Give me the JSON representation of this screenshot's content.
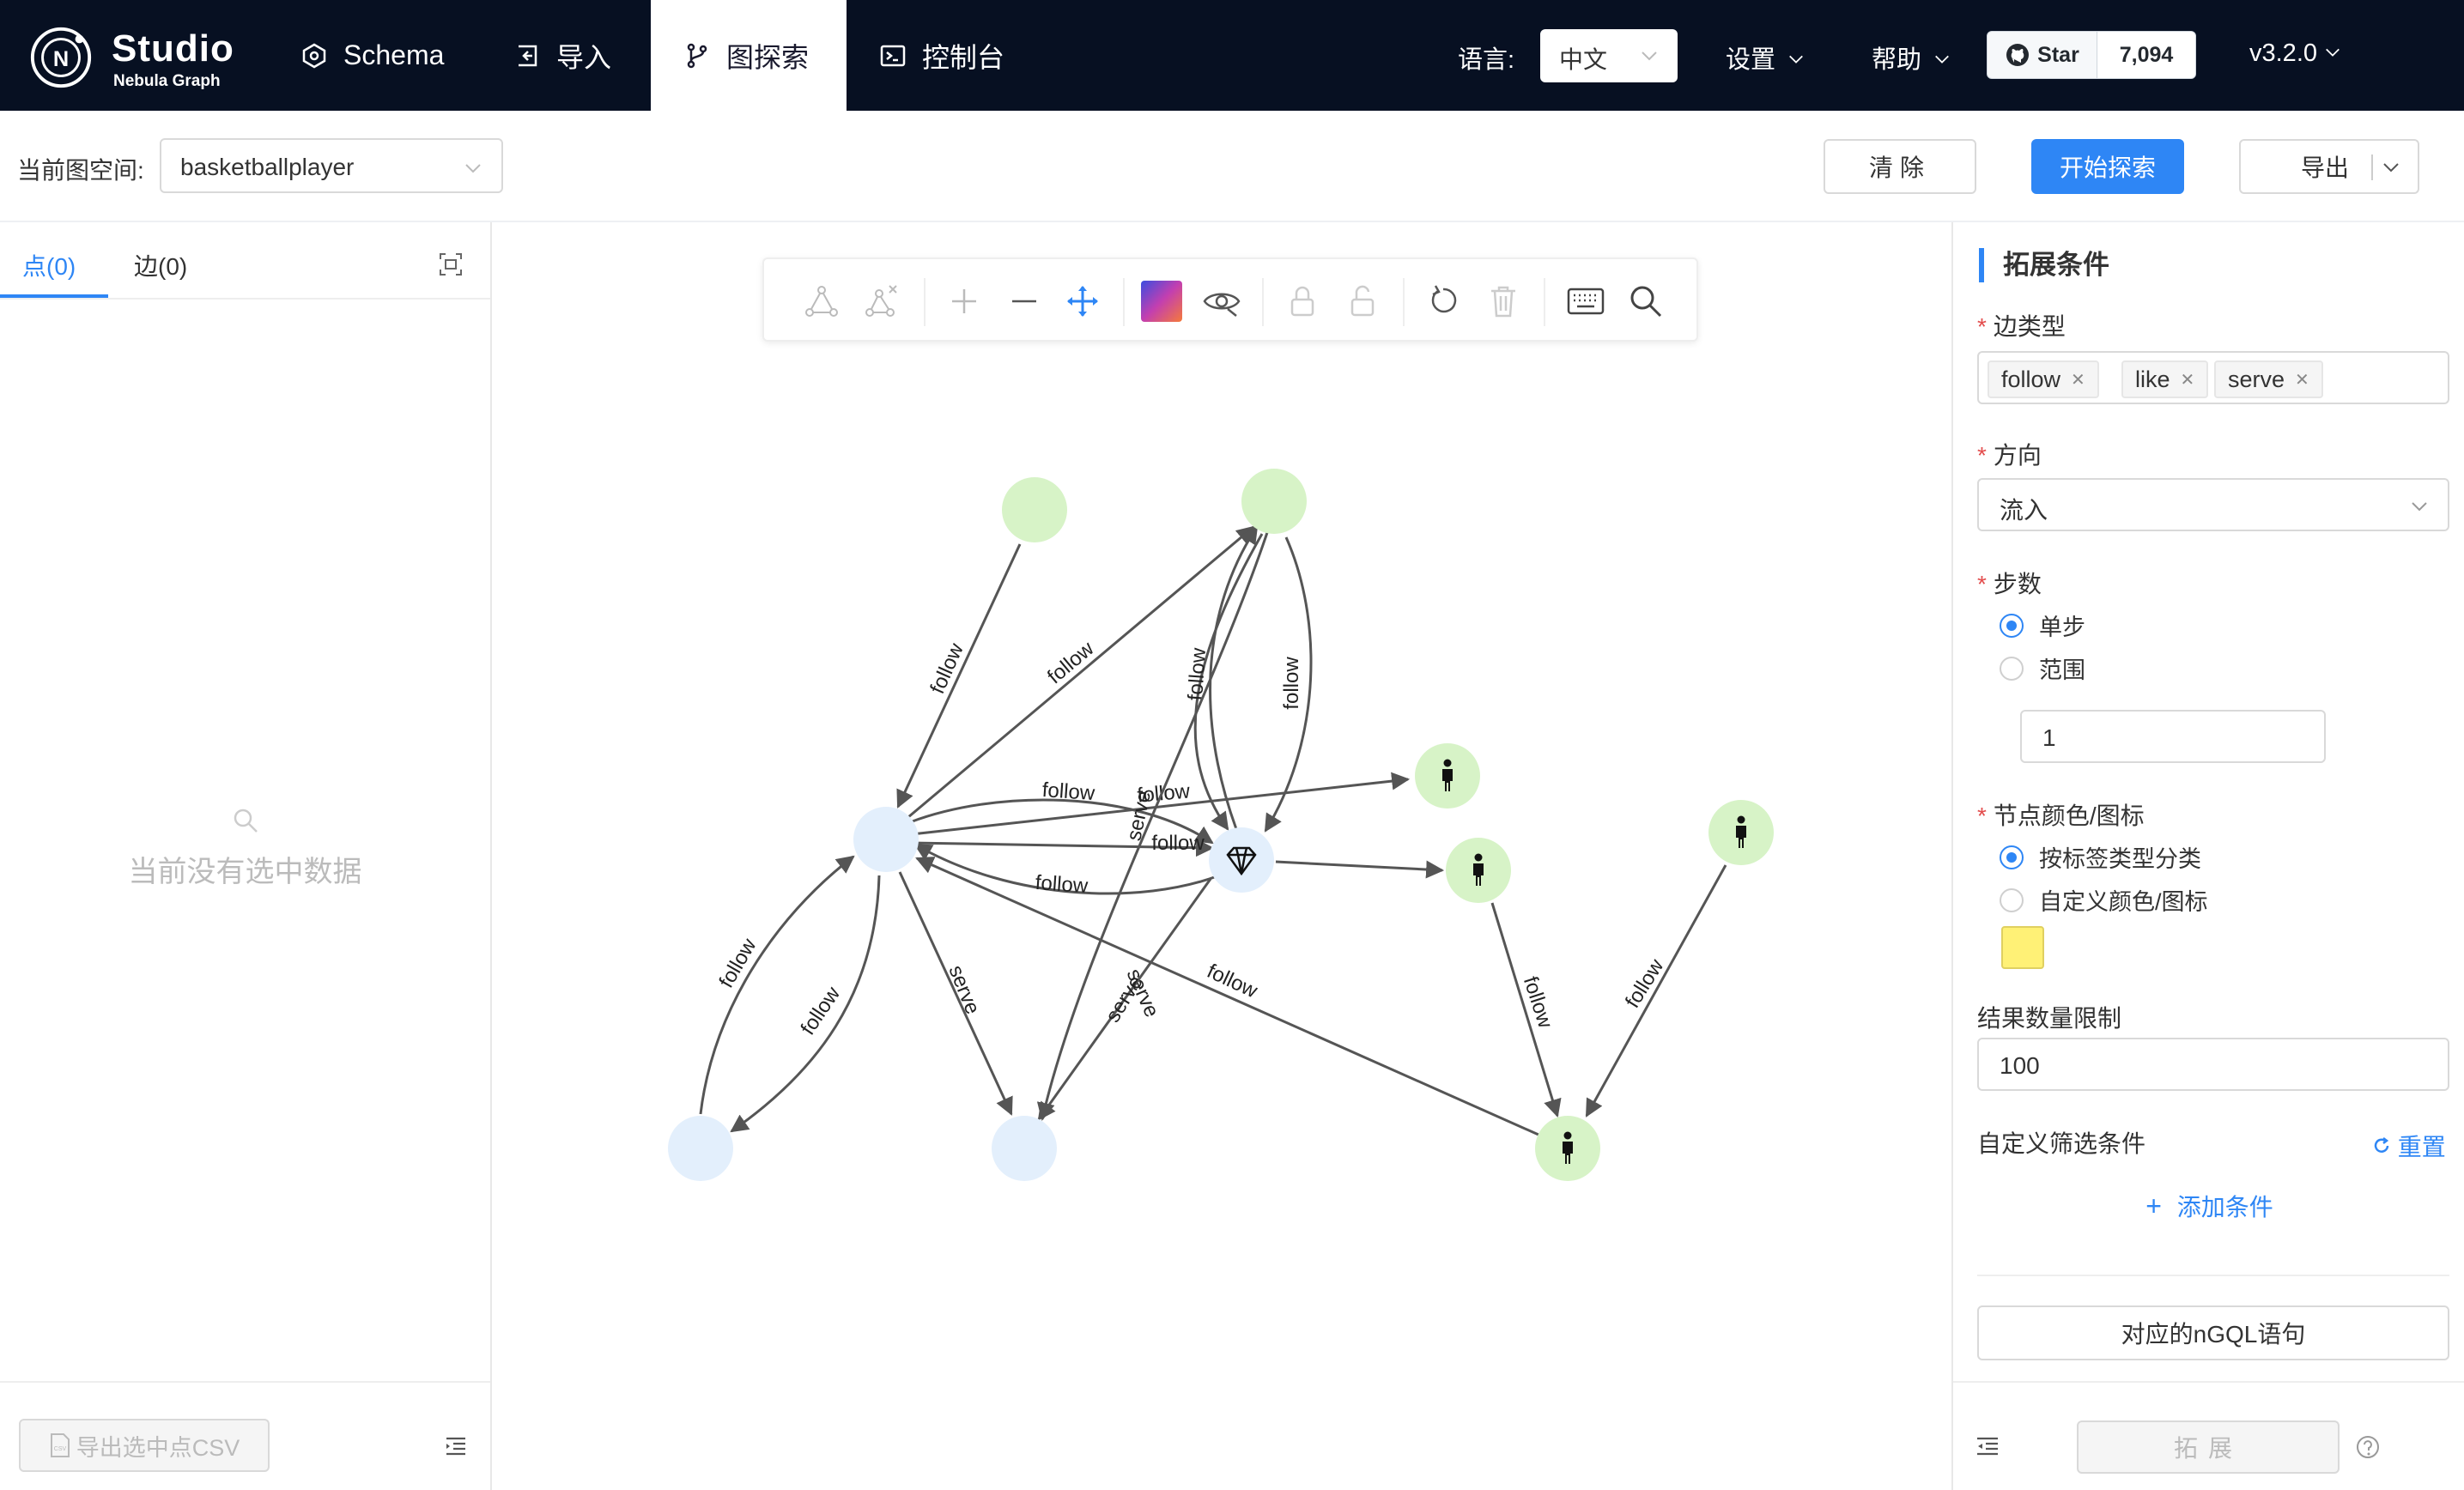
{
  "app": {
    "logo_title": "Studio",
    "logo_subtitle": "Nebula Graph"
  },
  "nav": {
    "items": [
      {
        "label": "Schema",
        "icon": "schema-icon"
      },
      {
        "label": "导入",
        "icon": "import-icon"
      },
      {
        "label": "图探索",
        "icon": "explore-icon",
        "active": true
      },
      {
        "label": "控制台",
        "icon": "console-icon"
      }
    ],
    "language_label": "语言:",
    "language_value": "中文",
    "settings_label": "设置",
    "help_label": "帮助",
    "github_star_label": "Star",
    "github_star_count": "7,094",
    "version": "v3.2.0"
  },
  "toolbar": {
    "space_label": "当前图空间:",
    "space_value": "basketballplayer",
    "clear_label": "清除",
    "explore_label": "开始探索",
    "export_label": "导出"
  },
  "left_panel": {
    "tabs": [
      {
        "label": "点(0)",
        "active": true
      },
      {
        "label": "边(0)"
      }
    ],
    "empty_text": "当前没有选中数据",
    "export_csv_label": "导出选中点CSV"
  },
  "graph_toolbar": {
    "tools": [
      "new-path-icon",
      "delete-path-icon",
      "zoom-in-icon",
      "zoom-out-icon",
      "move-icon",
      "color-palette-icon",
      "hide-icon",
      "lock-icon",
      "unlock-icon",
      "undo-icon",
      "delete-icon",
      "keyboard-icon",
      "search-icon"
    ]
  },
  "graph": {
    "colors": {
      "green_node": "#d7f3c7",
      "blue_node": "#e3effc",
      "edge": "#555555"
    },
    "nodes": [
      {
        "id": "n1",
        "kind": "green",
        "icon": ""
      },
      {
        "id": "n2",
        "kind": "green",
        "icon": ""
      },
      {
        "id": "center",
        "kind": "blue",
        "icon": ""
      },
      {
        "id": "diamond",
        "kind": "blue",
        "icon": "diamond-icon"
      },
      {
        "id": "p1",
        "kind": "green",
        "icon": "person-icon"
      },
      {
        "id": "p2",
        "kind": "green",
        "icon": "person-icon"
      },
      {
        "id": "p3",
        "kind": "green",
        "icon": "person-icon"
      },
      {
        "id": "p4",
        "kind": "green",
        "icon": "person-icon"
      },
      {
        "id": "b1",
        "kind": "blue",
        "icon": ""
      },
      {
        "id": "b2",
        "kind": "blue",
        "icon": ""
      }
    ],
    "edges": [
      {
        "label": "follow"
      },
      {
        "label": "follow"
      },
      {
        "label": "follow"
      },
      {
        "label": "follow"
      },
      {
        "label": "follow"
      },
      {
        "label": "serve"
      },
      {
        "label": "follow"
      },
      {
        "label": "follow"
      },
      {
        "label": "serve"
      },
      {
        "label": "follow"
      },
      {
        "label": "follow"
      },
      {
        "label": "serve"
      },
      {
        "label": "serve"
      },
      {
        "label": "follow"
      },
      {
        "label": "follow"
      },
      {
        "label": "follow"
      }
    ]
  },
  "right_panel": {
    "title": "拓展条件",
    "edge_type_label": "边类型",
    "edge_types": [
      "follow",
      "like",
      "serve"
    ],
    "direction_label": "方向",
    "direction_value": "流入",
    "steps_label": "步数",
    "step_options": [
      {
        "label": "单步",
        "selected": true
      },
      {
        "label": "范围",
        "selected": false
      }
    ],
    "step_value": "1",
    "node_style_label": "节点颜色/图标",
    "node_style_options": [
      {
        "label": "按标签类型分类",
        "selected": true
      },
      {
        "label": "自定义颜色/图标",
        "selected": false
      }
    ],
    "custom_color": "#fff176",
    "limit_label": "结果数量限制",
    "limit_value": "100",
    "custom_filter_label": "自定义筛选条件",
    "reset_label": "重置",
    "add_condition_label": "添加条件",
    "ngql_label": "对应的nGQL语句",
    "expand_label": "拓展"
  }
}
